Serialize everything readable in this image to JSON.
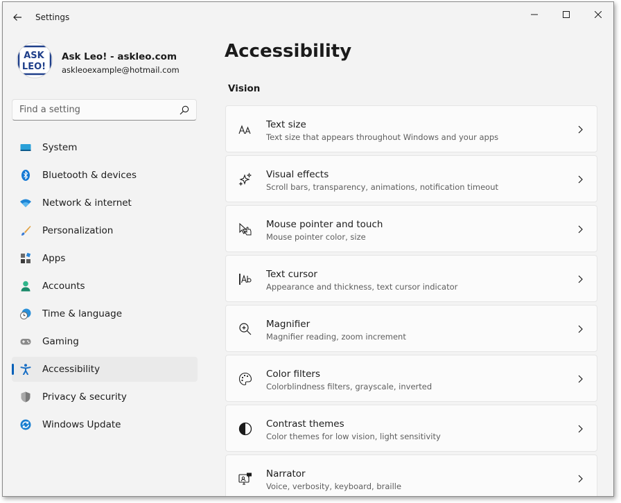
{
  "window": {
    "title": "Settings"
  },
  "profile": {
    "avatar_text_top": "ASK",
    "avatar_text_bottom": "LEO!",
    "name": "Ask Leo! - askleo.com",
    "email": "askleoexample@hotmail.com"
  },
  "search": {
    "placeholder": "Find a setting"
  },
  "nav": {
    "items": [
      {
        "label": "System",
        "icon": "system-icon",
        "active": false
      },
      {
        "label": "Bluetooth & devices",
        "icon": "bluetooth-icon",
        "active": false
      },
      {
        "label": "Network & internet",
        "icon": "wifi-icon",
        "active": false
      },
      {
        "label": "Personalization",
        "icon": "brush-icon",
        "active": false
      },
      {
        "label": "Apps",
        "icon": "apps-icon",
        "active": false
      },
      {
        "label": "Accounts",
        "icon": "person-icon",
        "active": false
      },
      {
        "label": "Time & language",
        "icon": "clock-globe-icon",
        "active": false
      },
      {
        "label": "Gaming",
        "icon": "gamepad-icon",
        "active": false
      },
      {
        "label": "Accessibility",
        "icon": "accessibility-icon",
        "active": true
      },
      {
        "label": "Privacy & security",
        "icon": "shield-icon",
        "active": false
      },
      {
        "label": "Windows Update",
        "icon": "update-icon",
        "active": false
      }
    ]
  },
  "main": {
    "title": "Accessibility",
    "section": "Vision",
    "cards": [
      {
        "title": "Text size",
        "subtitle": "Text size that appears throughout Windows and your apps",
        "icon": "text-size-icon"
      },
      {
        "title": "Visual effects",
        "subtitle": "Scroll bars, transparency, animations, notification timeout",
        "icon": "sparkle-icon"
      },
      {
        "title": "Mouse pointer and touch",
        "subtitle": "Mouse pointer color, size",
        "icon": "pointer-touch-icon"
      },
      {
        "title": "Text cursor",
        "subtitle": "Appearance and thickness, text cursor indicator",
        "icon": "text-cursor-icon"
      },
      {
        "title": "Magnifier",
        "subtitle": "Magnifier reading, zoom increment",
        "icon": "magnifier-icon"
      },
      {
        "title": "Color filters",
        "subtitle": "Colorblindness filters, grayscale, inverted",
        "icon": "palette-icon"
      },
      {
        "title": "Contrast themes",
        "subtitle": "Color themes for low vision, light sensitivity",
        "icon": "contrast-icon"
      },
      {
        "title": "Narrator",
        "subtitle": "Voice, verbosity, keyboard, braille",
        "icon": "narrator-icon"
      }
    ]
  },
  "colors": {
    "accent": "#005fb8",
    "window_bg": "#f3f3f3",
    "card_bg": "#fbfbfb"
  }
}
